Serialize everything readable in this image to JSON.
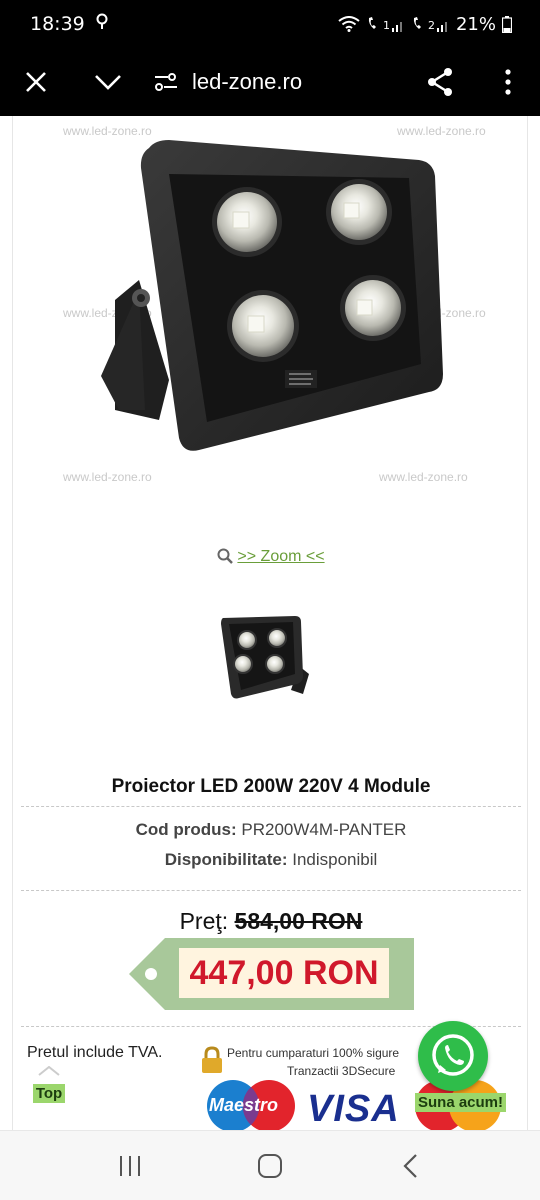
{
  "status": {
    "time": "18:39",
    "battery": "21%",
    "sim1": "1",
    "sim2": "2"
  },
  "toolbar": {
    "url": "led-zone.ro"
  },
  "product": {
    "watermarks": [
      "www.led-zone.ro",
      "www.led-zone.ro",
      "www.led-zone.ro",
      "www.led-zone.ro",
      "www.led-zone.ro",
      "www.led-zone.ro"
    ],
    "zoom_label": ">> Zoom <<",
    "title": "Proiector LED 200W 220V 4 Module",
    "code_label": "Cod produs:",
    "code_value": "PR200W4M-PANTER",
    "availability_label": "Disponibilitate:",
    "availability_value": "Indisponibil",
    "price_label": "Preţ:",
    "old_price": "584,00 RON",
    "new_price": "447,00 RON",
    "vat_note": "Pretul include TVA.",
    "secure_line1": "Pentru cumparaturi 100% sigure",
    "secure_line2": "Tranzactii 3DSecure",
    "card_maestro": "Maestro",
    "card_visa": "VISA",
    "top_label": "Top",
    "call_label": "Suna acum!"
  },
  "colors": {
    "accent_green": "#9bd66c",
    "price_red": "#d0182b",
    "tag_green": "#a8c89a",
    "whatsapp": "#2fbd4a"
  }
}
